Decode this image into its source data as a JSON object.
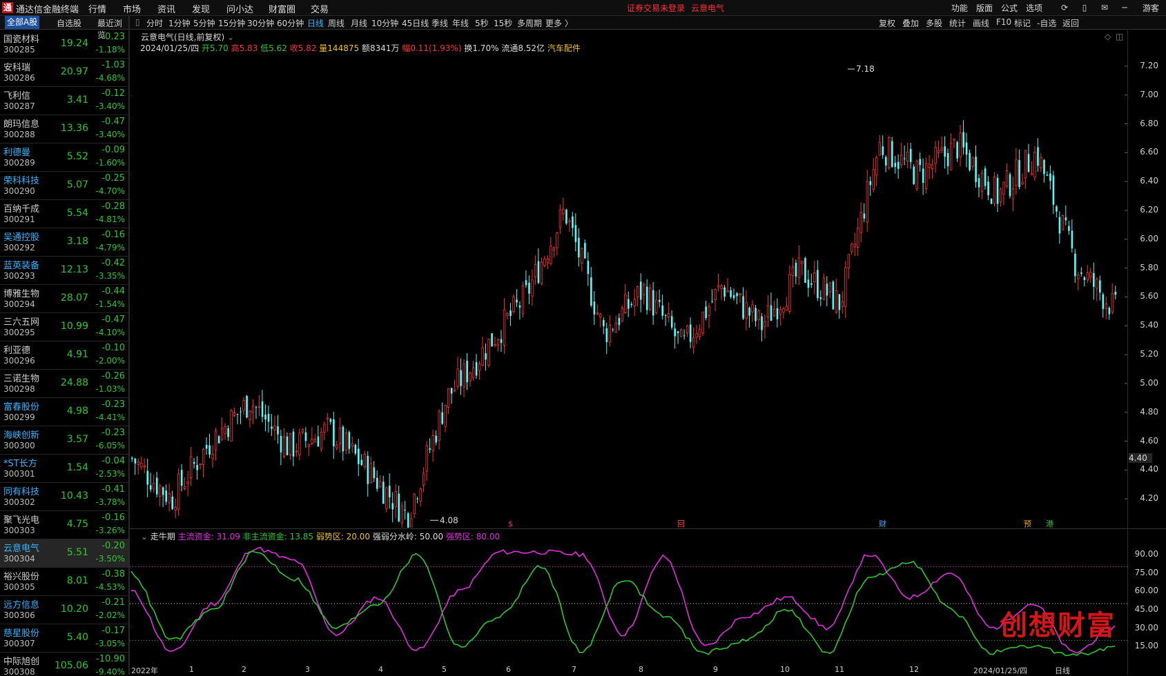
{
  "app": {
    "logo": "通",
    "title": "通达信金融终端"
  },
  "top_menu": [
    "行情",
    "市场",
    "资讯",
    "发现",
    "问小达",
    "财富圈",
    "交易"
  ],
  "login_status": "证券交易未登录",
  "top_stock_name": "云意电气",
  "right_menu": [
    "功能",
    "版面",
    "公式",
    "选项"
  ],
  "guest_label": "游客",
  "left_tabs": [
    "全部A股",
    "自选股",
    "最近浏览"
  ],
  "stocks": [
    {
      "name": "国瓷材料",
      "code": "300285",
      "price": "19.24",
      "change": "-0.23",
      "pct": "-1.18%",
      "blue": false
    },
    {
      "name": "安科瑞",
      "code": "300286",
      "price": "20.97",
      "change": "-1.03",
      "pct": "-4.68%",
      "blue": false
    },
    {
      "name": "飞利信",
      "code": "300287",
      "price": "3.41",
      "change": "-0.12",
      "pct": "-3.40%",
      "blue": false
    },
    {
      "name": "朗玛信息",
      "code": "300288",
      "price": "13.36",
      "change": "-0.47",
      "pct": "-3.40%",
      "blue": false
    },
    {
      "name": "利德曼",
      "code": "300289",
      "price": "5.52",
      "change": "-0.09",
      "pct": "-1.60%",
      "blue": true
    },
    {
      "name": "荣科科技",
      "code": "300290",
      "price": "5.07",
      "change": "-0.25",
      "pct": "-4.70%",
      "blue": true
    },
    {
      "name": "百纳千成",
      "code": "300291",
      "price": "5.54",
      "change": "-0.28",
      "pct": "-4.81%",
      "blue": false
    },
    {
      "name": "吴通控股",
      "code": "300292",
      "price": "3.18",
      "change": "-0.16",
      "pct": "-4.79%",
      "blue": true
    },
    {
      "name": "蓝英装备",
      "code": "300293",
      "price": "12.13",
      "change": "-0.42",
      "pct": "-3.35%",
      "blue": true
    },
    {
      "name": "博雅生物",
      "code": "300294",
      "price": "28.07",
      "change": "-0.44",
      "pct": "-1.54%",
      "blue": false
    },
    {
      "name": "三六五网",
      "code": "300295",
      "price": "10.99",
      "change": "-0.47",
      "pct": "-4.10%",
      "blue": false
    },
    {
      "name": "利亚德",
      "code": "300296",
      "price": "4.91",
      "change": "-0.10",
      "pct": "-2.00%",
      "blue": false
    },
    {
      "name": "三诺生物",
      "code": "300298",
      "price": "24.88",
      "change": "-0.26",
      "pct": "-1.03%",
      "blue": false
    },
    {
      "name": "富春股份",
      "code": "300299",
      "price": "4.98",
      "change": "-0.23",
      "pct": "-4.41%",
      "blue": true
    },
    {
      "name": "海峡创新",
      "code": "300300",
      "price": "3.57",
      "change": "-0.23",
      "pct": "-6.05%",
      "blue": true
    },
    {
      "name": "*ST长方",
      "code": "300301",
      "price": "1.54",
      "change": "-0.04",
      "pct": "-2.53%",
      "blue": true
    },
    {
      "name": "同有科技",
      "code": "300302",
      "price": "10.43",
      "change": "-0.41",
      "pct": "-3.78%",
      "blue": true
    },
    {
      "name": "聚飞光电",
      "code": "300303",
      "price": "4.75",
      "change": "-0.16",
      "pct": "-3.26%",
      "blue": false
    },
    {
      "name": "云意电气",
      "code": "300304",
      "price": "5.51",
      "change": "-0.20",
      "pct": "-3.50%",
      "blue": true
    },
    {
      "name": "裕兴股份",
      "code": "300305",
      "price": "8.01",
      "change": "-0.38",
      "pct": "-4.53%",
      "blue": false
    },
    {
      "name": "远方信息",
      "code": "300306",
      "price": "10.20",
      "change": "-0.21",
      "pct": "-2.02%",
      "blue": true
    },
    {
      "name": "慈星股份",
      "code": "300307",
      "price": "5.40",
      "change": "-0.17",
      "pct": "-3.05%",
      "blue": true
    },
    {
      "name": "中际旭创",
      "code": "300308",
      "price": "105.06",
      "change": "-10.90",
      "pct": "-9.40%",
      "blue": false
    }
  ],
  "periods": [
    "分时",
    "1分钟",
    "5分钟",
    "15分钟",
    "30分钟",
    "60分钟",
    "日线",
    "周线",
    "月线",
    "10分钟",
    "45日线",
    "季线",
    "年线",
    "5秒",
    "15秒",
    "多周期",
    "更多 〉"
  ],
  "active_period": "日线",
  "tools": [
    "复权",
    "叠加",
    "多股",
    "统计",
    "画线",
    "F10",
    "标记",
    "-自选",
    "返回"
  ],
  "chart": {
    "title": "云意电气(日线,前复权)",
    "date": "2024/01/25/四",
    "open": "开5.70",
    "high": "高5.83",
    "low": "低5.62",
    "close": "收5.82",
    "volume": "量144875",
    "amount": "额8341万",
    "amplitude": "幅0.11(1.93%)",
    "turnover": "换1.70%",
    "float": "流通8.52亿",
    "sector": "汽车配件",
    "high_label": "7.18",
    "low_label": "4.08",
    "current_price_tag": "4.40",
    "events": [
      {
        "label": "回",
        "color": "#ff4040"
      },
      {
        "label": "财",
        "color": "#3ab4ff"
      },
      {
        "label": "预",
        "color": "#f0a020"
      },
      {
        "label": "港",
        "color": "#2ec82e"
      },
      {
        "label": "$",
        "color": "#ff3232"
      }
    ]
  },
  "indicator": {
    "name": "走牛期",
    "main_fund": "主流资金: 31.09",
    "non_main_fund": "非主流资金: 13.85",
    "weak": "弱势区: 20.00",
    "divide": "强弱分水岭: 50.00",
    "strong": "强势区: 80.00"
  },
  "chart_data": [
    {
      "type": "candlestick",
      "title": "云意电气(日线,前复权)",
      "ylim": [
        4.0,
        7.3
      ],
      "y_ticks": [
        "7.20",
        "7.00",
        "6.80",
        "6.60",
        "6.40",
        "6.20",
        "6.00",
        "5.80",
        "5.60",
        "5.40",
        "5.20",
        "5.00",
        "4.80",
        "4.60",
        "4.40",
        "4.20"
      ],
      "x_labels": [
        "2022年",
        "1",
        "2",
        "3",
        "4",
        "5",
        "6",
        "7",
        "8",
        "9",
        "10",
        "11",
        "12",
        "2024/01/25/四",
        "日线"
      ],
      "approx_close_path": [
        4.48,
        4.2,
        4.6,
        4.88,
        4.55,
        4.68,
        4.4,
        4.08,
        4.9,
        5.25,
        5.6,
        6.2,
        5.35,
        5.65,
        5.25,
        5.68,
        5.4,
        5.78,
        5.55,
        6.65,
        6.45,
        6.65,
        6.3,
        6.6,
        5.82,
        5.51
      ]
    },
    {
      "type": "line",
      "title": "走牛期",
      "ylim": [
        0,
        100
      ],
      "y_ticks": [
        "90.00",
        "75.00",
        "60.00",
        "45.00",
        "30.00",
        "15.00"
      ],
      "series": [
        {
          "name": "主流资金",
          "values": [
            60,
            10,
            50,
            95,
            85,
            25,
            55,
            12,
            60,
            92,
            92,
            90,
            25,
            88,
            15,
            40,
            55,
            30,
            90,
            55,
            75,
            30,
            50,
            10,
            31.09
          ]
        },
        {
          "name": "非主流资金",
          "values": [
            75,
            20,
            45,
            92,
            70,
            30,
            50,
            90,
            15,
            40,
            80,
            10,
            70,
            40,
            10,
            20,
            45,
            10,
            70,
            85,
            45,
            10,
            15,
            8,
            13.85
          ]
        }
      ]
    }
  ]
}
